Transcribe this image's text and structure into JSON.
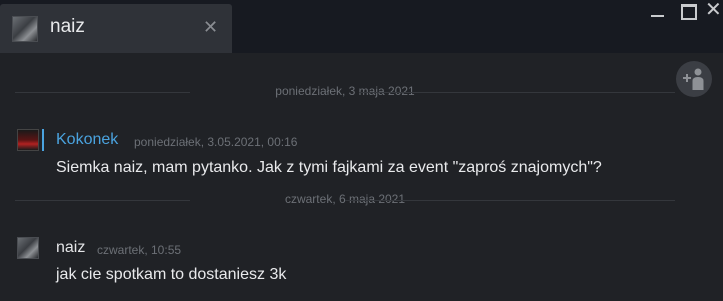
{
  "window": {
    "tab": {
      "title": "naiz",
      "close_glyph": "✕",
      "avatar_icon": "user-avatar-icon"
    },
    "controls": {
      "minimize_icon": "minimize-icon",
      "maximize_icon": "maximize-icon",
      "close_glyph": "✕"
    },
    "add_friend_icon": "add-friend-icon"
  },
  "chat": {
    "dividers": [
      {
        "label": "poniedziałek, 3 maja 2021"
      },
      {
        "label": "czwartek, 6 maja 2021"
      }
    ],
    "messages": [
      {
        "sender": "Kokonek",
        "timestamp": "poniedziałek, 3.05.2021, 00:16",
        "text": "Siemka naiz, mam pytanko. Jak z tymi fajkami za event \"zaproś znajomych\"?",
        "sender_color": "#4aa3df"
      },
      {
        "sender": "naiz",
        "timestamp": "czwartek, 10:55",
        "text": "jak cie spotkam to dostaniesz 3k",
        "sender_color": "#e4e5e7"
      }
    ]
  },
  "colors": {
    "background": "#202226",
    "titlebar": "#171a21",
    "tab": "#2f3238",
    "accent": "#4aa3df"
  }
}
